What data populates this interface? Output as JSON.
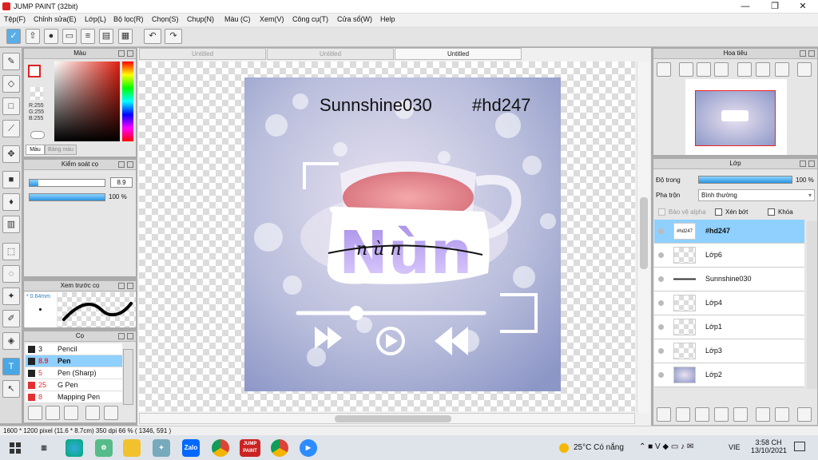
{
  "window": {
    "title": "JUMP PAINT (32bit)",
    "min": "—",
    "restore": "❐",
    "close": "✕"
  },
  "menu": [
    "Tệp(F)",
    "Chỉnh sửa(E)",
    "Lớp(L)",
    "Bộ lọc(R)",
    "Chọn(S)",
    "Chụp(N)",
    "Màu (C)",
    "Xem(V)",
    "Công cụ(T)",
    "Cửa sổ(W)",
    "Help"
  ],
  "color_panel": {
    "title": "Màu",
    "r": "R:255",
    "g": "G:255",
    "b": "B:255",
    "tab_color": "Màu",
    "tab_palette": "Bảng màu"
  },
  "brush_control": {
    "title": "Kiểm soát cọ",
    "size": "8.9",
    "opacity": "100 %",
    "size_fill": 0.12,
    "opacity_fill": 1.0
  },
  "brush_preview": {
    "title": "Xem trước cọ",
    "size_label": "* 0.64mm"
  },
  "brush_list": {
    "title": "Cọ",
    "items": [
      {
        "size": "3",
        "name": "Pencil",
        "color": "#222222"
      },
      {
        "size": "8.9",
        "name": "Pen",
        "color": "#222222",
        "selected": true
      },
      {
        "size": "5",
        "name": "Pen (Sharp)",
        "color": "#222222"
      },
      {
        "size": "25",
        "name": "G Pen",
        "color": "#e53030"
      },
      {
        "size": "8",
        "name": "Mapping Pen",
        "color": "#e53030"
      }
    ]
  },
  "tabs": [
    "Untitled",
    "Untitled",
    "Untitled"
  ],
  "artwork": {
    "username": "Sunnshine030",
    "hashtag": "#hd247",
    "big_word": "Nùn",
    "script_word": "n  ù  n"
  },
  "navigator": {
    "title": "Hoa tiêu"
  },
  "layer_panel": {
    "title": "Lớp",
    "opacity_label": "Độ trong",
    "opacity_value": "100 %",
    "blend_label": "Pha trộn",
    "blend_value": "Bình thường",
    "protect_alpha": "Bảo vệ alpha",
    "clipping": "Xén bớt",
    "lock": "Khóa",
    "layers": [
      {
        "name": "#hd247",
        "thumb": "#hd247",
        "selected": true
      },
      {
        "name": "Lớp6"
      },
      {
        "name": "Sunnshine030"
      },
      {
        "name": "Lớp4"
      },
      {
        "name": "Lớp1"
      },
      {
        "name": "Lớp3"
      },
      {
        "name": "Lớp2"
      }
    ]
  },
  "status": {
    "text": "1600 * 1200 pixel   (11.6 * 8.7cm)   350 dpi   66 %   ( 1346, 591 )"
  },
  "taskbar": {
    "weather": "25°C  Có nắng",
    "lang": "VIE",
    "time": "3:58 CH",
    "date": "13/10/2021",
    "zalo": "Zalo",
    "jp": "JUMP PAINT"
  },
  "colors": {
    "accent": "#2a95e0",
    "selected_row": "#8fd0ff"
  }
}
